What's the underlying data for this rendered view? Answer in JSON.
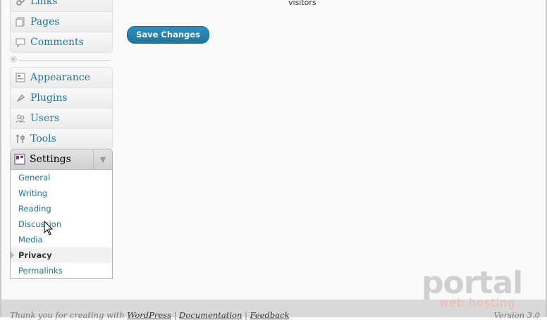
{
  "content": {
    "visitors_text": "visitors",
    "save_button": "Save Changes"
  },
  "sidebar": {
    "top_group": [
      {
        "label": "Links",
        "icon": "links-icon"
      },
      {
        "label": "Pages",
        "icon": "pages-icon"
      },
      {
        "label": "Comments",
        "icon": "comments-icon"
      }
    ],
    "collapse_symbol": "«",
    "main_group": [
      {
        "label": "Appearance",
        "icon": "appearance-icon"
      },
      {
        "label": "Plugins",
        "icon": "plugins-icon"
      },
      {
        "label": "Users",
        "icon": "users-icon"
      },
      {
        "label": "Tools",
        "icon": "tools-icon"
      }
    ],
    "settings": {
      "label": "Settings",
      "toggle_symbol": "▼",
      "submenu": [
        {
          "label": "General"
        },
        {
          "label": "Writing"
        },
        {
          "label": "Reading"
        },
        {
          "label": "Discussion"
        },
        {
          "label": "Media"
        },
        {
          "label": "Privacy",
          "current": true
        },
        {
          "label": "Permalinks"
        }
      ]
    }
  },
  "footer": {
    "thanks_prefix": "Thank you for creating with ",
    "wordpress_link": "WordPress",
    "separator": " | ",
    "documentation_link": "Documentation",
    "feedback_link": "Feedback",
    "version": "Version 3.0"
  },
  "watermark": {
    "main": "portal",
    "sub": "web hosting"
  },
  "colors": {
    "link": "#21759b",
    "button": "#21759b"
  }
}
